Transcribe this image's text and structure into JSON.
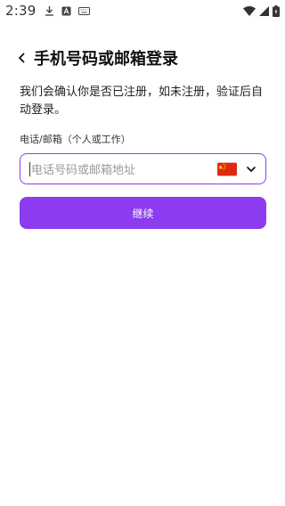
{
  "status_bar": {
    "time": "2:39",
    "left_icons": [
      "download-icon",
      "notification-a-icon",
      "keyboard-icon"
    ],
    "right_icons": [
      "wifi-icon",
      "signal-icon",
      "battery-icon"
    ]
  },
  "header": {
    "title": "手机号码或邮箱登录"
  },
  "description": "我们会确认你是否已注册，如未注册，验证后自动登录。",
  "form": {
    "label": "电话/邮箱（个人或工作）",
    "placeholder": "电话号码或邮箱地址",
    "country_flag": "china-flag-icon"
  },
  "continue_label": "继续",
  "colors": {
    "accent": "#8b3cf0",
    "placeholder": "#9a9a9a"
  }
}
